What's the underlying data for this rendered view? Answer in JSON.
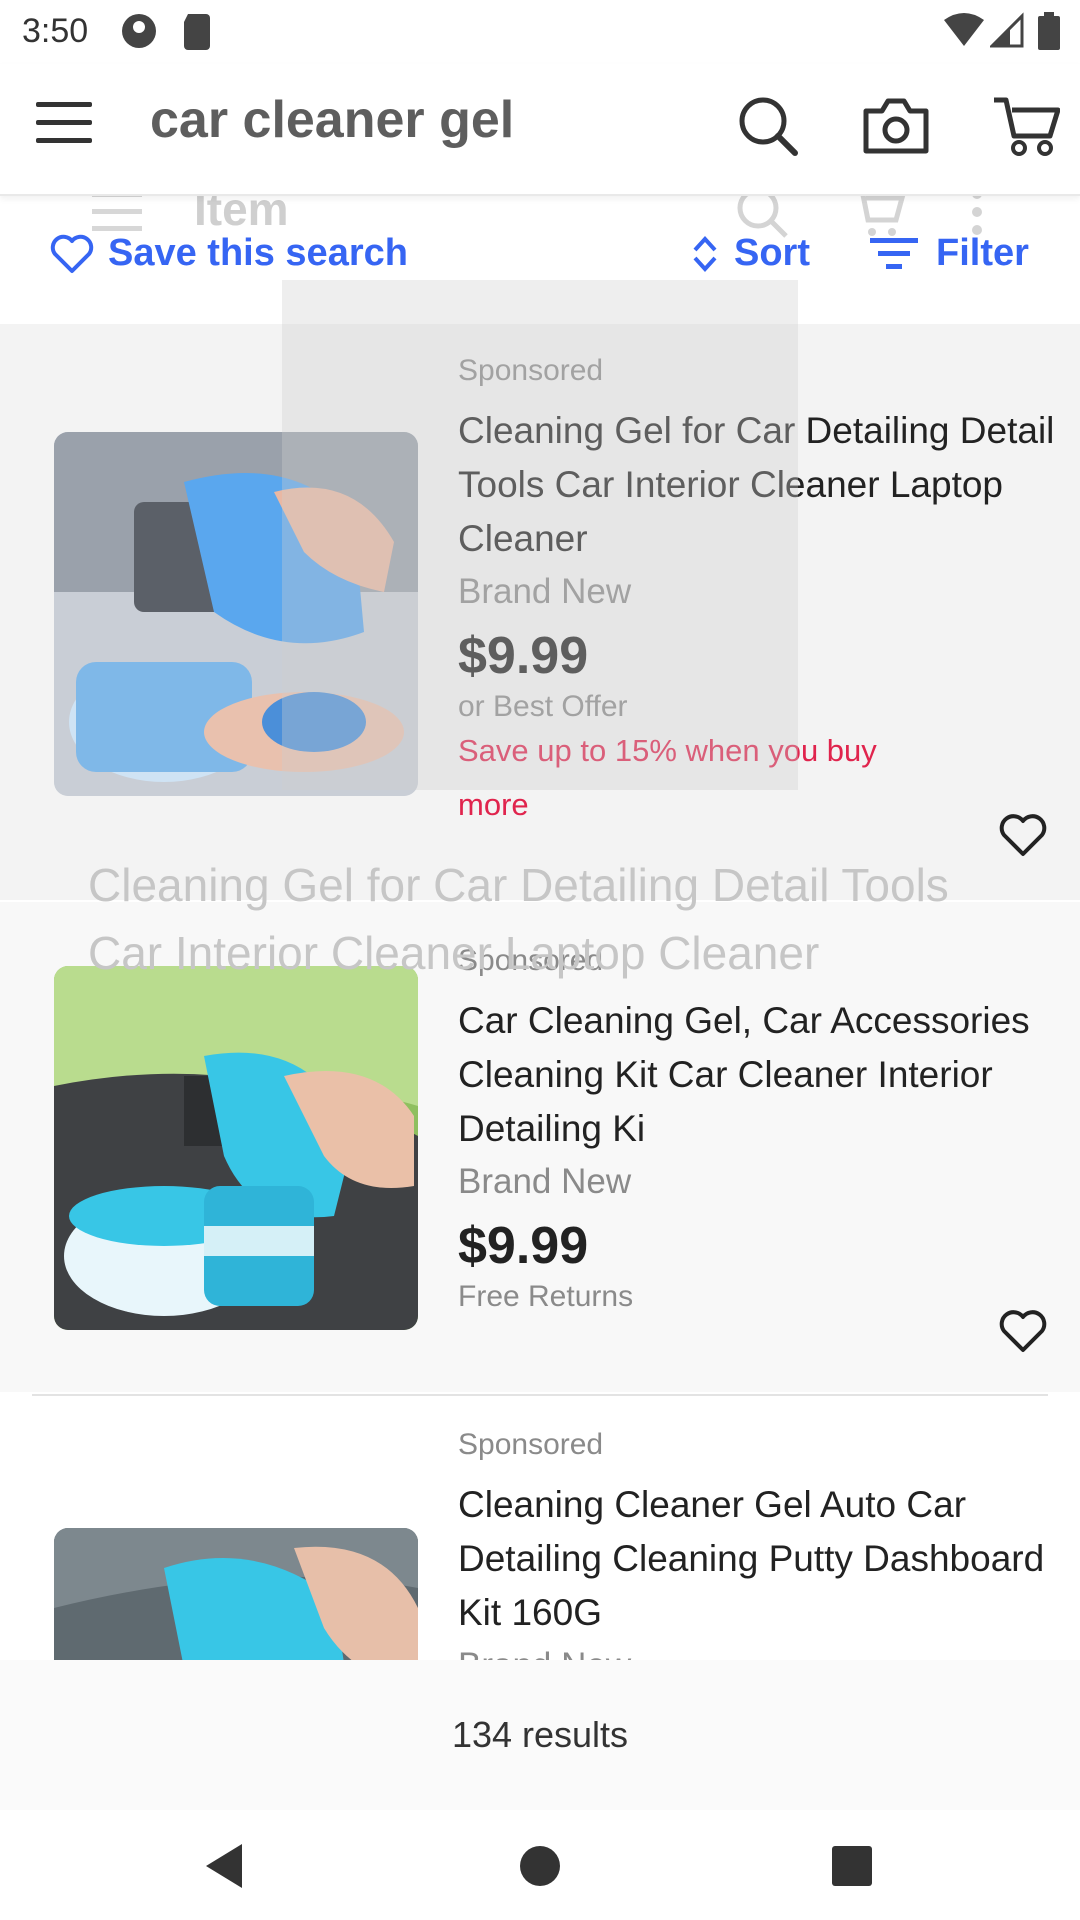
{
  "status_bar": {
    "time": "3:50"
  },
  "search_bar": {
    "query": "car cleaner gel"
  },
  "ghost_overlay": {
    "item_label": "Item",
    "title_line1": "Cleaning Gel for Car Detailing Detail Tools",
    "title_line2": "Car Interior Cleaner Laptop Cleaner"
  },
  "filters": {
    "save_search": "Save this search",
    "sort": "Sort",
    "filter": "Filter"
  },
  "listings": [
    {
      "sponsored": "Sponsored",
      "title": "Cleaning Gel for Car Detailing Detail Tools Car Interior Cleaner Laptop Cleaner",
      "condition": "Brand New",
      "price": "$9.99",
      "offer": "or Best Offer",
      "promo": "Save up to 15% when you buy more"
    },
    {
      "sponsored": "Sponsored",
      "title": "Car Cleaning Gel, Car Accessories Cleaning Kit Car Cleaner Interior Detailing Ki",
      "condition": "Brand New",
      "price": "$9.99",
      "returns": "Free Returns"
    },
    {
      "sponsored": "Sponsored",
      "title": "Cleaning Cleaner Gel Auto Car Detailing  Cleaning Putty Dashboard Kit 160G",
      "condition": "Brand New"
    }
  ],
  "results": {
    "count_text": "134 results"
  },
  "colors": {
    "link_blue": "#3665f3",
    "promo_red": "#e0244d",
    "gel_blue": "#5aa7ee",
    "gel_teal": "#38c6e6"
  }
}
